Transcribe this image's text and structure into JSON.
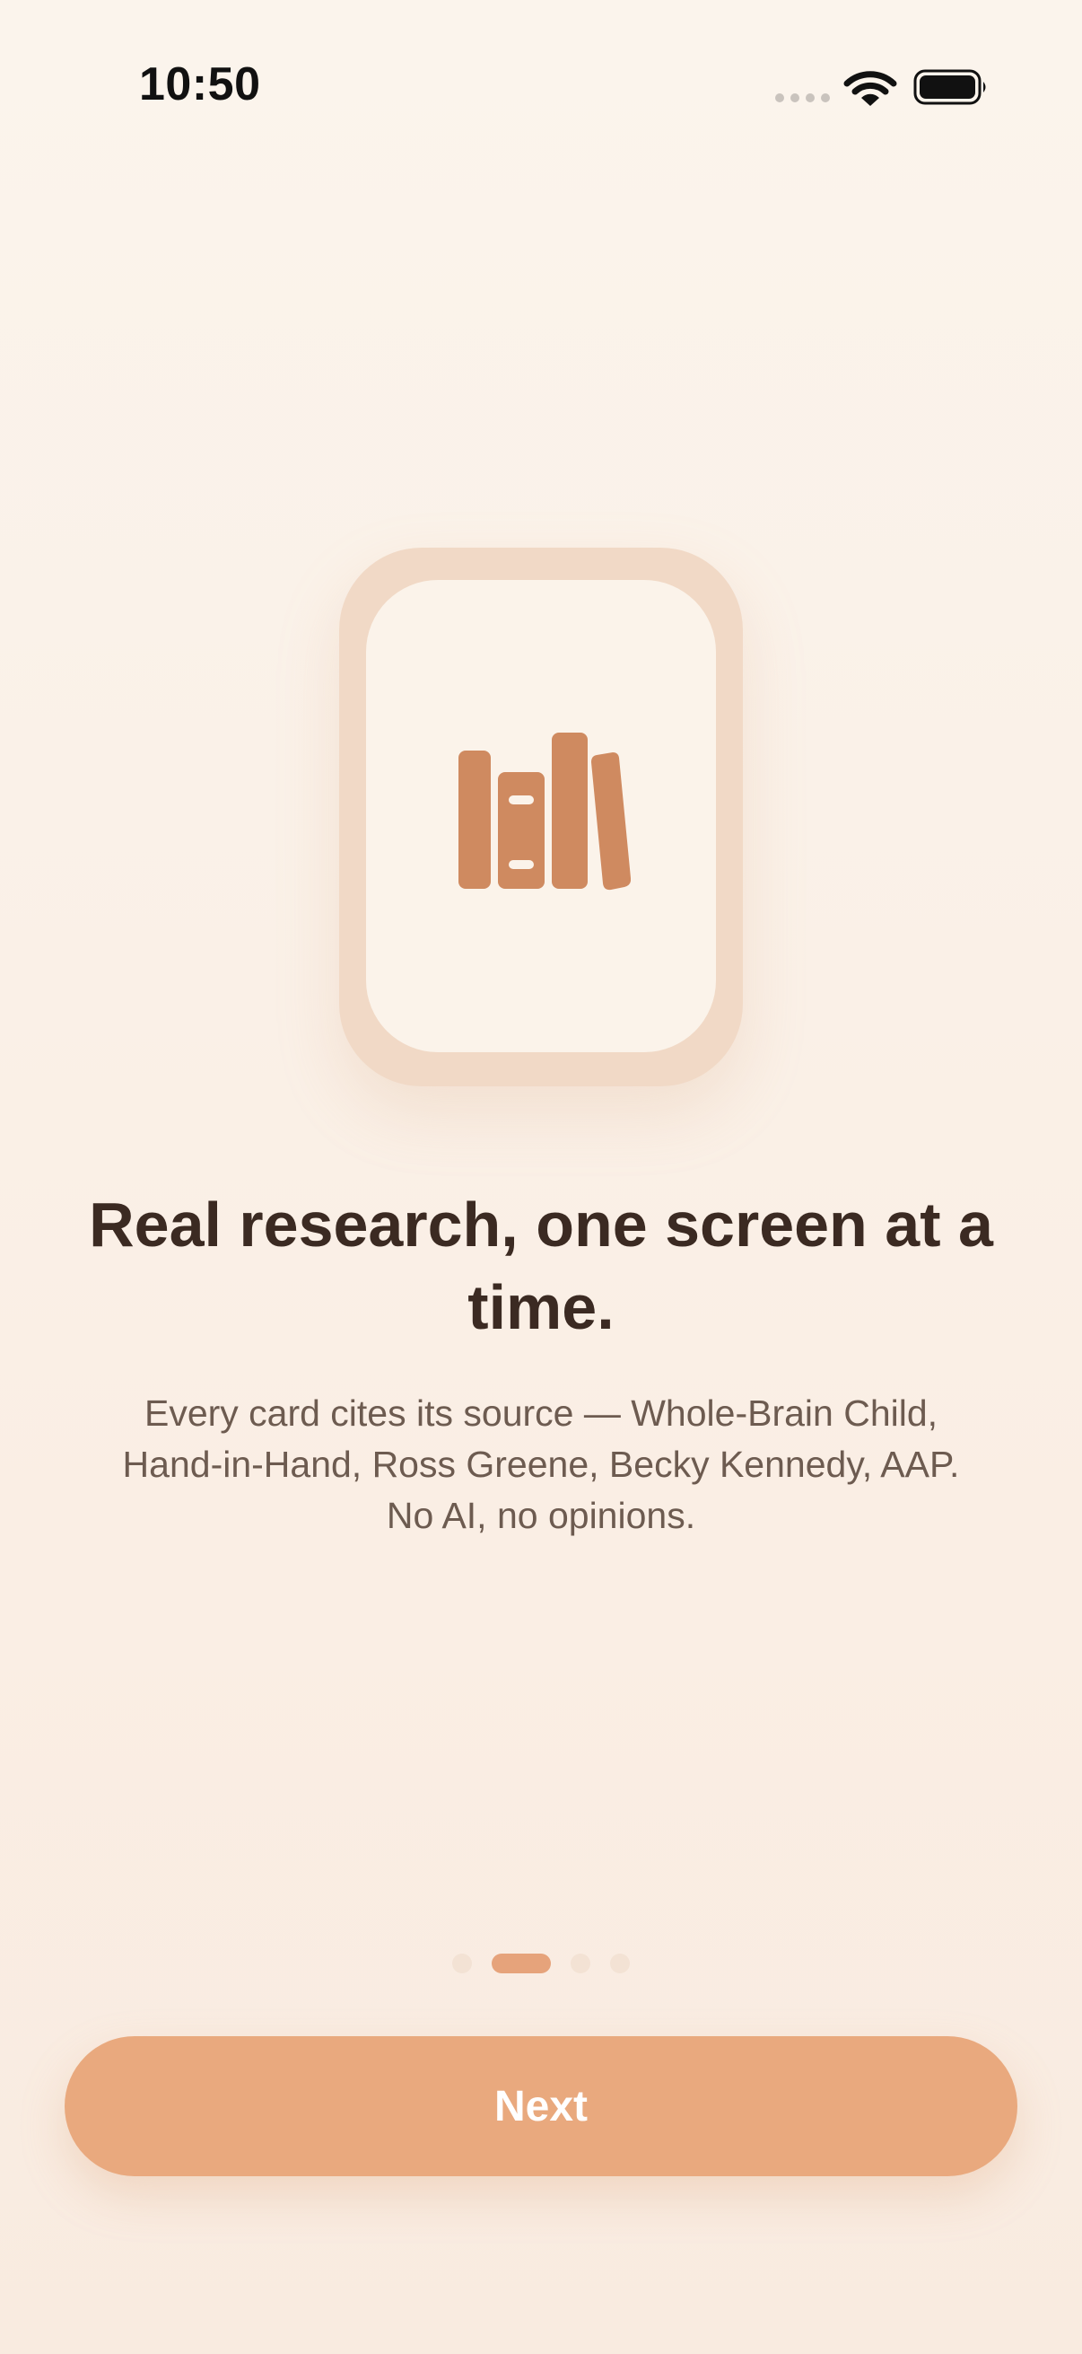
{
  "status_bar": {
    "time": "10:50",
    "icons": [
      "signal-dots-icon",
      "wifi-icon",
      "battery-icon"
    ]
  },
  "illustration": {
    "icon": "books-icon",
    "color": "#cf8a60"
  },
  "onboarding": {
    "headline": "Real research, one screen at a time.",
    "body": "Every card cites its source — Whole-Brain Child, Hand-in-Hand, Ross Greene, Becky Kennedy, AAP. No AI, no opinions."
  },
  "pagination": {
    "total": 4,
    "current": 2
  },
  "actions": {
    "next_label": "Next"
  },
  "colors": {
    "accent": "#e9a97e",
    "headline": "#3b2a22",
    "body": "#6d5b50",
    "background": "#fbf4ec"
  }
}
